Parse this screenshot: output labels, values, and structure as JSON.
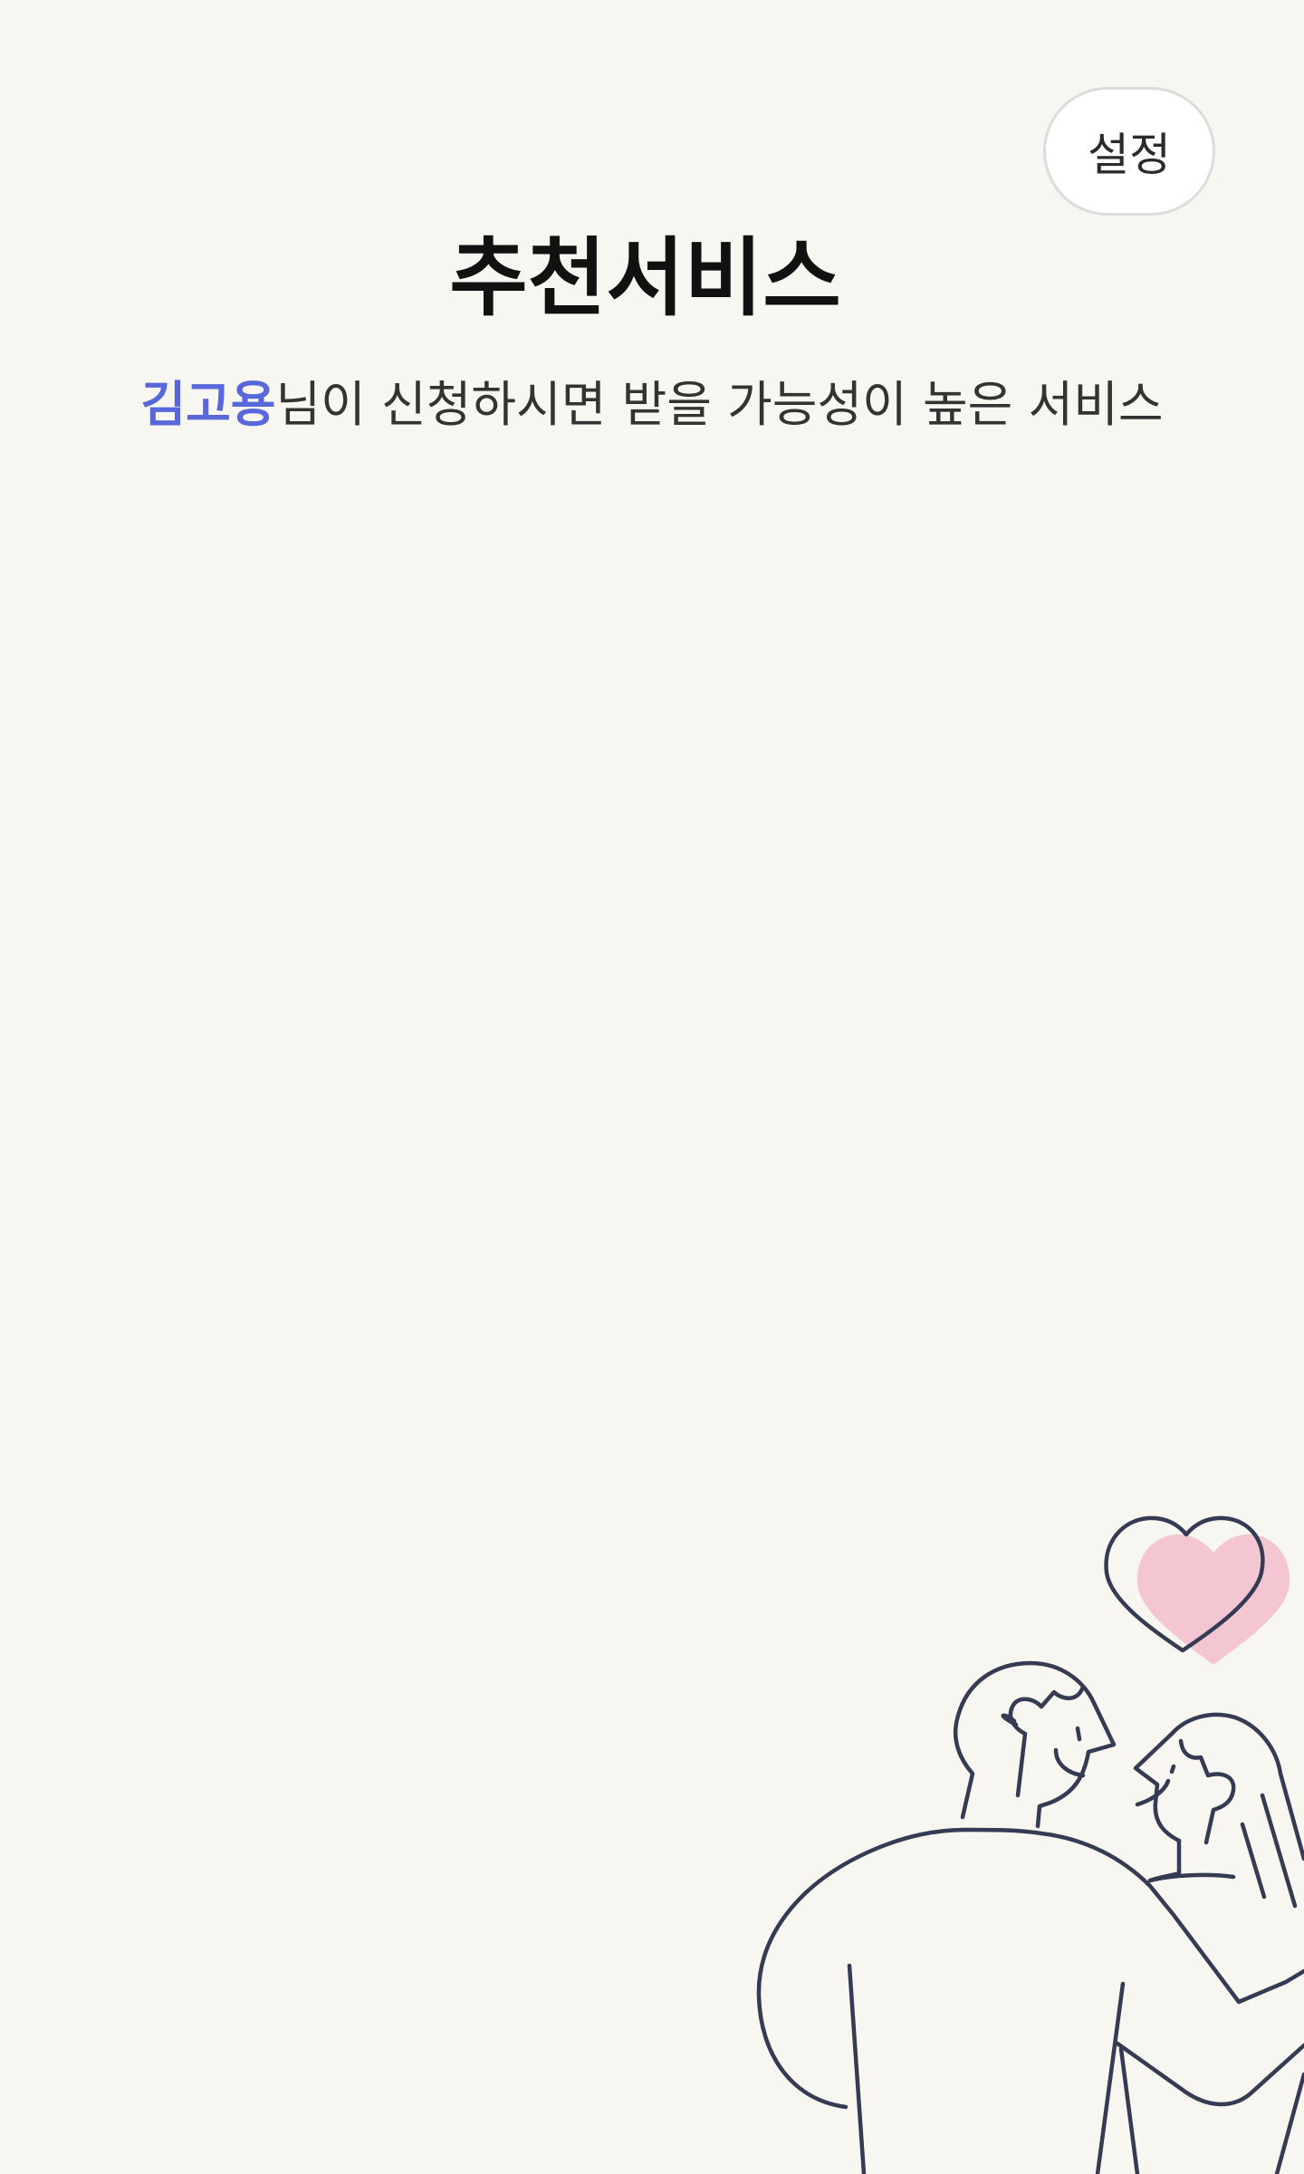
{
  "header": {
    "settings_label": "설정"
  },
  "page": {
    "title": "추천서비스",
    "user_name": "김고용",
    "subtitle_rest": "님이 신청하시면 받을 가능성이 높은 서비스"
  },
  "illustration": {
    "line_color": "#343b52",
    "heart_fill": "#f4c6d2"
  },
  "colors": {
    "background": "#f7f6f0",
    "accent": "#5868dc"
  }
}
